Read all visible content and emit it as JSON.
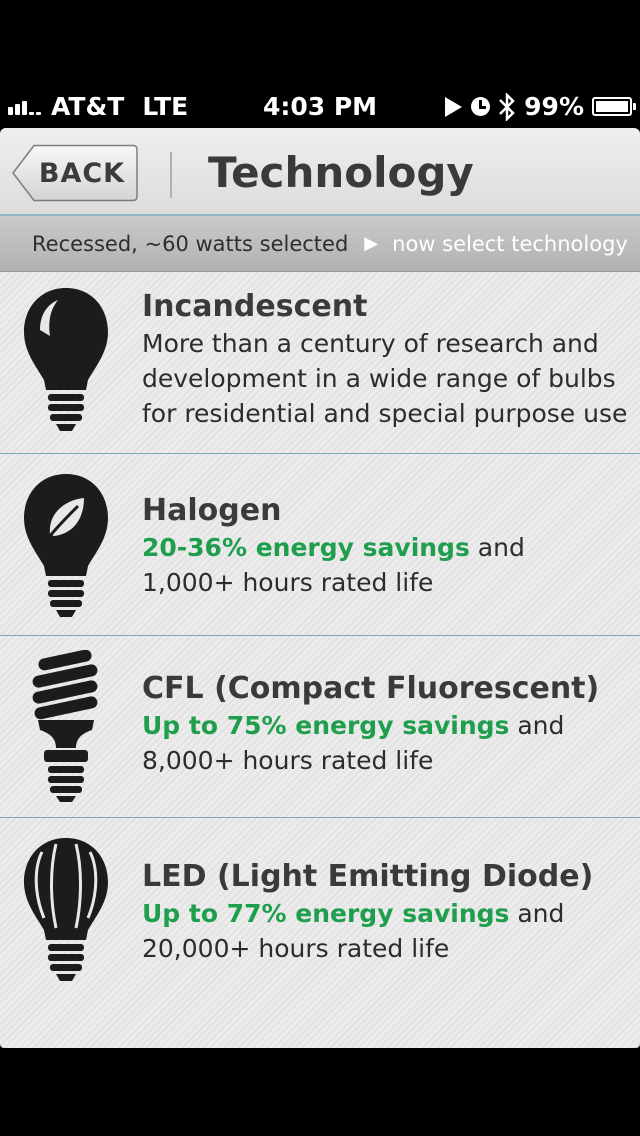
{
  "status_bar": {
    "carrier": "AT&T",
    "network": "LTE",
    "time": "4:03 PM",
    "battery": "99%",
    "battery_level": 0.99,
    "icons": [
      "play-icon",
      "clock-icon",
      "bluetooth-icon",
      "battery-icon"
    ]
  },
  "nav": {
    "back_label": "BACK",
    "title": "Technology"
  },
  "sub_bar": {
    "selected": "Recessed, ~60 watts selected",
    "next": "now select technology"
  },
  "technologies": [
    {
      "icon": "incandescent-bulb-icon",
      "title": "Incandescent",
      "desc_lines": [
        "More than a century of research and",
        "development in a wide range of bulbs",
        "for residential and special purpose use"
      ]
    },
    {
      "icon": "halogen-bulb-icon",
      "title": "Halogen",
      "highlight": "20-36% energy savings",
      "after_highlight": " and",
      "second_line": "1,000+ hours rated life"
    },
    {
      "icon": "cfl-bulb-icon",
      "title": "CFL (Compact Fluorescent)",
      "highlight": "Up to 75% energy savings",
      "after_highlight": " and",
      "second_line": "8,000+ hours rated life"
    },
    {
      "icon": "led-bulb-icon",
      "title": "LED (Light Emitting Diode)",
      "highlight": "Up to 77% energy savings",
      "after_highlight": " and",
      "second_line": "20,000+ hours rated life"
    }
  ],
  "colors": {
    "highlight_green": "#1f9e4d",
    "divider": "#7fa9b7",
    "icon_dark": "#1c1c1c"
  }
}
